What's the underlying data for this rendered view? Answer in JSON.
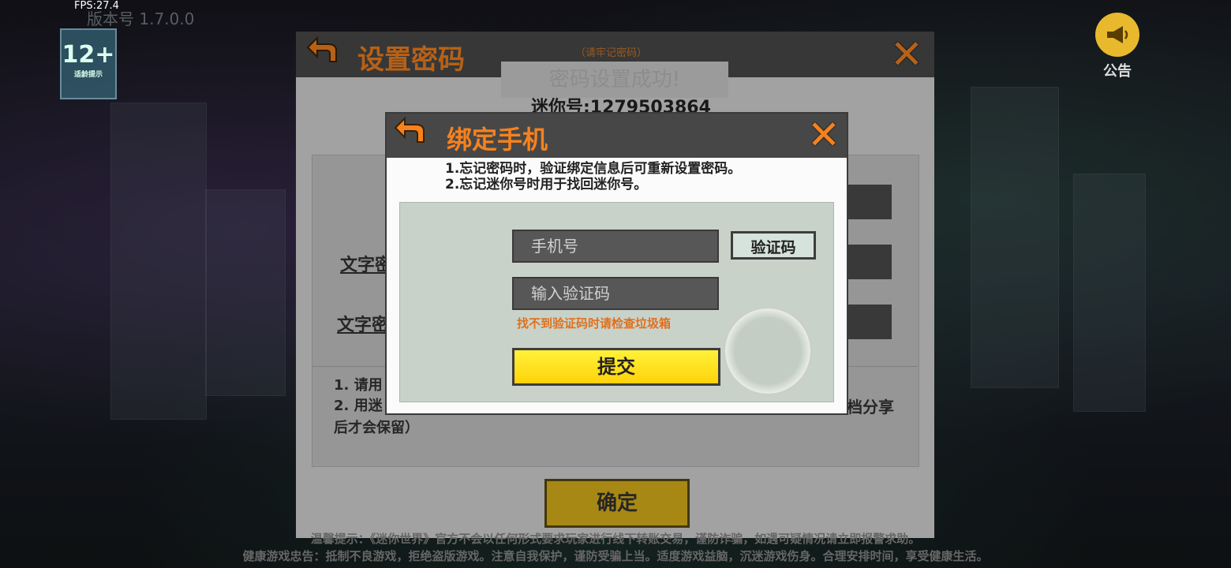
{
  "overlay": {
    "fps": "FPS:27.4",
    "version": "版本号 1.7.0.0",
    "age_rating": "12+",
    "age_sub": "适龄提示",
    "notice_label": "公告",
    "footer_line1": "温馨提示：《迷你世界》官方不会以任何形式要求玩家进行线下转账交易，谨防诈骗，如遇可疑情况请立即报警求助。",
    "footer_line2": "健康游戏忠告：抵制不良游戏，拒绝盗版游戏。注意自我保护，谨防受骗上当。适度游戏益脑，沉迷游戏伤身。合理安排时间，享受健康生活。"
  },
  "set_password_panel": {
    "title": "设置密码",
    "subtitle_hint": "（请牢记密码）",
    "ghost_title": "密码设置成功!",
    "mini_id": "迷你号:1279503864",
    "label_1": "文字密",
    "label_2": "文字密",
    "note_1": "1. 请用",
    "note_2": "2. 用迷",
    "note_3": "后才会保留）",
    "note_right": "档分享",
    "confirm_label": "确定"
  },
  "bind_phone_dialog": {
    "title": "绑定手机",
    "tip_1": "1.忘记密码时，验证绑定信息后可重新设置密码。",
    "tip_2": "2.忘记迷你号时用于找回迷你号。",
    "phone_placeholder": "手机号",
    "code_placeholder": "输入验证码",
    "get_code_label": "验证码",
    "spam_hint": "找不到验证码时请检查垃圾箱",
    "submit_label": "提交"
  },
  "icons": {
    "back": "back-arrow-icon",
    "close": "close-x-icon",
    "megaphone": "megaphone-icon"
  },
  "colors": {
    "accent_orange": "#f5821f",
    "submit_yellow": "#ffd20a",
    "confirm_gold": "#e0b61d",
    "hint_orange": "#e0701c"
  }
}
